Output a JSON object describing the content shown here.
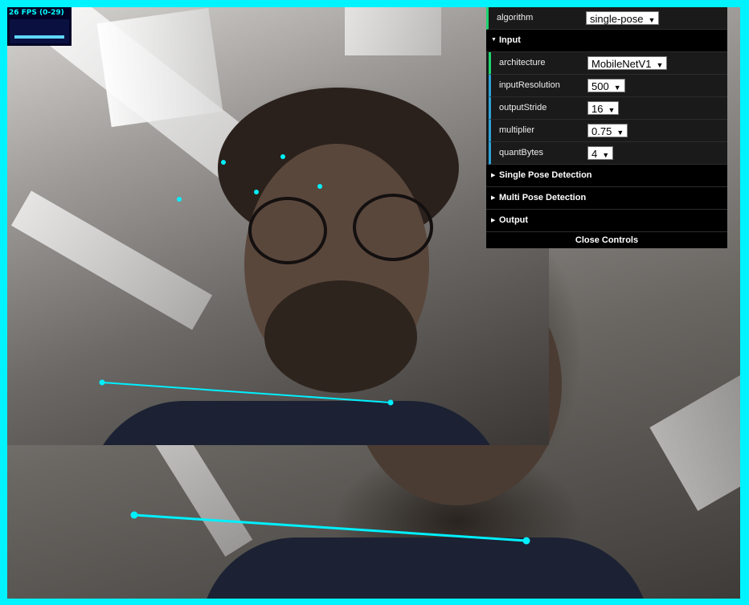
{
  "stats": {
    "fps_label": "26 FPS (0-29)"
  },
  "gui": {
    "algorithm": {
      "label": "algorithm",
      "value": "single-pose"
    },
    "input_folder": "Input",
    "architecture": {
      "label": "architecture",
      "value": "MobileNetV1"
    },
    "inputResolution": {
      "label": "inputResolution",
      "value": "500"
    },
    "outputStride": {
      "label": "outputStride",
      "value": "16"
    },
    "multiplier": {
      "label": "multiplier",
      "value": "0.75"
    },
    "quantBytes": {
      "label": "quantBytes",
      "value": "4"
    },
    "folders": [
      "Single Pose Detection",
      "Multi Pose Detection",
      "Output"
    ],
    "close_label": "Close Controls"
  },
  "colors": {
    "frame": "#00f3ff",
    "keypoint": "#00f0ff",
    "panel": "#1a1a1a"
  },
  "icons": {
    "expanded": "triangle-down-icon",
    "collapsed": "triangle-right-icon",
    "dropdown": "caret-down-icon"
  }
}
